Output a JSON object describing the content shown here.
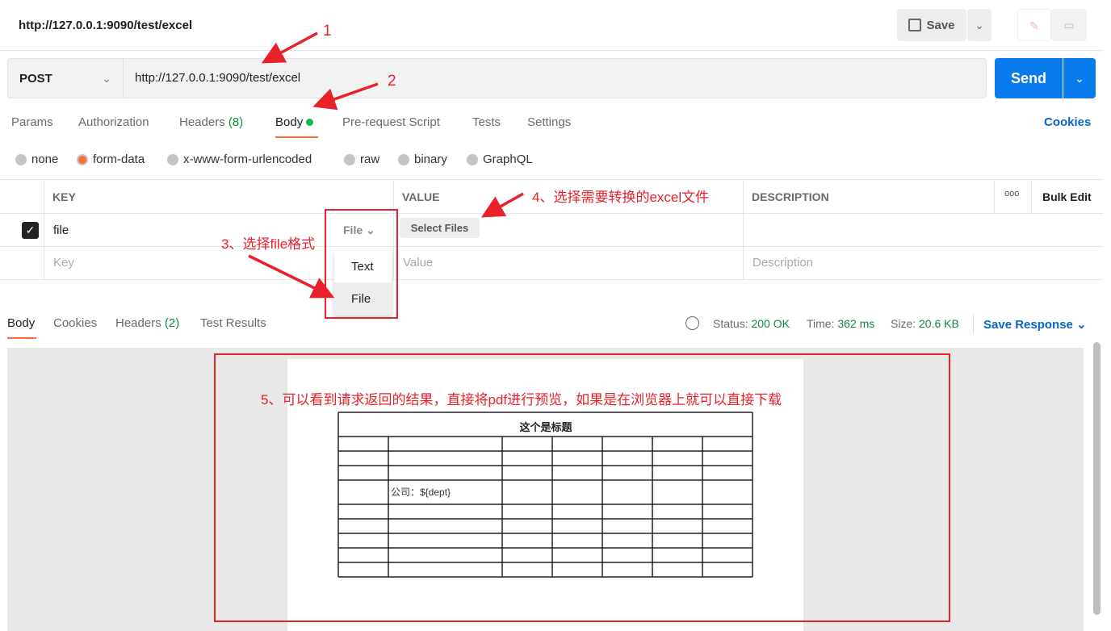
{
  "header": {
    "tab_title": "http://127.0.0.1:9090/test/excel",
    "save_label": "Save"
  },
  "request": {
    "method": "POST",
    "url": "http://127.0.0.1:9090/test/excel",
    "send_label": "Send"
  },
  "tabs": [
    {
      "label": "Params"
    },
    {
      "label": "Authorization"
    },
    {
      "label": "Headers",
      "count": "(8)"
    },
    {
      "label": "Body"
    },
    {
      "label": "Pre-request Script"
    },
    {
      "label": "Tests"
    },
    {
      "label": "Settings"
    }
  ],
  "cookies_link": "Cookies",
  "body_types": [
    "none",
    "form-data",
    "x-www-form-urlencoded",
    "raw",
    "binary",
    "GraphQL"
  ],
  "body_type_selected": "form-data",
  "table": {
    "headers": [
      "KEY",
      "VALUE",
      "DESCRIPTION"
    ],
    "bulk_edit": "Bulk Edit",
    "more": "ooo",
    "rows": [
      {
        "checked": true,
        "key": "file",
        "type": "File",
        "value_button": "Select Files"
      }
    ],
    "placeholder": {
      "key": "Key",
      "value": "Value",
      "description": "Description"
    }
  },
  "type_menu": {
    "options": [
      "Text",
      "File"
    ],
    "selected": "File"
  },
  "response": {
    "tabs": [
      {
        "label": "Body"
      },
      {
        "label": "Cookies"
      },
      {
        "label": "Headers",
        "count": "(2)"
      },
      {
        "label": "Test Results"
      }
    ],
    "status_label": "Status:",
    "status": "200 OK",
    "time_label": "Time:",
    "time": "362 ms",
    "size_label": "Size:",
    "size": "20.6 KB",
    "save_response": "Save Response"
  },
  "pdf": {
    "title": "这个是标题",
    "cell_text": "公司：${dept}"
  },
  "annotations": {
    "a1": "1",
    "a2": "2",
    "a3": "3、选择file格式",
    "a4": "4、选择需要转换的excel文件",
    "a5": "5、可以看到请求返回的结果，直接将pdf进行预览，如果是在浏览器上就可以直接下载"
  },
  "colors": {
    "accent": "#ff6c37",
    "send": "#097bed",
    "link": "#0b65c9",
    "annotation": "#e8212a",
    "status_ok": "#0f8a3a"
  }
}
